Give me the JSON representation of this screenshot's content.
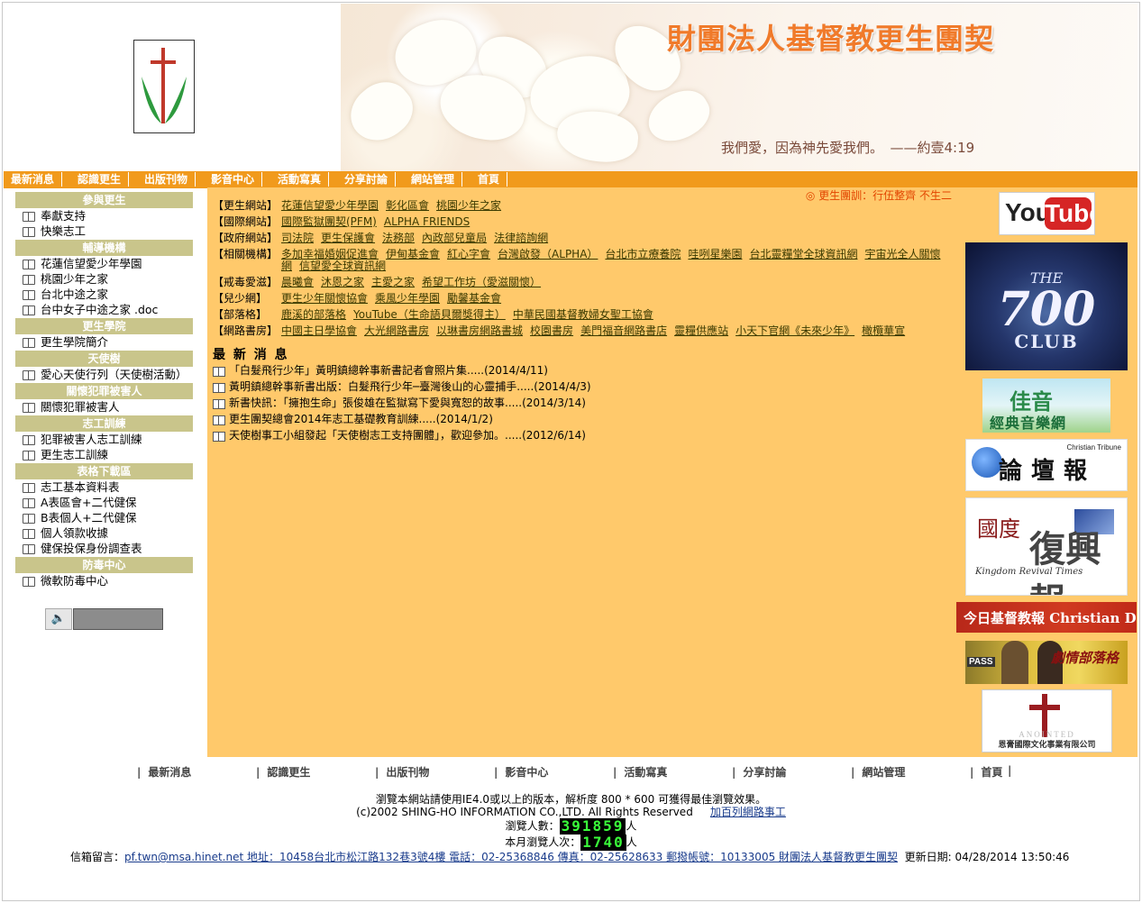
{
  "header": {
    "org_title": "財團法人基督教更生團契",
    "verse": "我們愛，因為神先愛我們。　——約壹4:19"
  },
  "nav": [
    "最新消息",
    "認識更生",
    "出版刊物",
    "影音中心",
    "活動寫真",
    "分享討論",
    "網站管理",
    "首頁"
  ],
  "sidebar": {
    "sections": [
      {
        "title": "參與更生",
        "items": [
          "奉獻支持",
          "快樂志工"
        ]
      },
      {
        "title": "輔導機構",
        "items": [
          "花蓮信望愛少年學園",
          "桃園少年之家",
          "台北中途之家",
          "台中女子中途之家 .doc"
        ]
      },
      {
        "title": "更生學院",
        "items": [
          "更生學院簡介"
        ]
      },
      {
        "title": "天使樹",
        "items": [
          "愛心天使行列（天使樹活動）"
        ]
      },
      {
        "title": "關懷犯罪被害人",
        "items": [
          "關懷犯罪被害人"
        ]
      },
      {
        "title": "志工訓練",
        "items": [
          "犯罪被害人志工訓練",
          "更生志工訓練"
        ]
      },
      {
        "title": "表格下載區",
        "items": [
          "志工基本資料表",
          "A表區會+二代健保",
          "B表個人+二代健保",
          "個人領款收據",
          "健保投保身份調查表"
        ]
      },
      {
        "title": "防毒中心",
        "items": [
          "微軟防毒中心"
        ]
      }
    ],
    "player_icon": "speaker-icon"
  },
  "main": {
    "marquee": "◎ 更生團訓：行伍整齊 不生二",
    "link_rows": [
      {
        "label": "【更生網站】",
        "items": [
          "花蓮信望愛少年學園",
          "彰化區會",
          "桃園少年之家"
        ]
      },
      {
        "label": "【國際網站】",
        "items": [
          "國際監獄團契(PFM)",
          "ALPHA FRIENDS"
        ]
      },
      {
        "label": "【政府網站】",
        "items": [
          "司法院",
          "更生保護會",
          "法務部",
          "內政部兒童局",
          "法律諮詢網"
        ]
      },
      {
        "label": "【相關機構】",
        "items": [
          "多加幸福婚姻促進會",
          "伊甸基金會",
          "紅心字會",
          "台灣啟發（ALPHA）",
          "台北市立療養院",
          "哇咧星樂園",
          "台北靈糧堂全球資訊網",
          "宇宙光全人關懷網",
          "信望愛全球資訊網"
        ]
      },
      {
        "label": "【戒毒愛滋】",
        "items": [
          "晨曦會",
          "沐恩之家",
          "主愛之家",
          "希望工作坊（愛滋關懷）"
        ]
      },
      {
        "label": "【兒少網】",
        "items": [
          "更生少年關懷協會",
          "乘風少年學園",
          "勵馨基金會"
        ]
      },
      {
        "label": "【部落格】",
        "items": [
          "鹿溪的部落格",
          "YouTube（生命語貝爾獎得主）",
          "中華民國基督教婦女聖工協會"
        ]
      },
      {
        "label": "【網路書房】",
        "items": [
          "中國主日學協會",
          "大光網路書房",
          "以琳書房網路書城",
          "校園書房",
          "美門福音網路書店",
          "靈糧供應站",
          "小天下官網《未來少年》",
          "橄欖華宣"
        ]
      }
    ],
    "news_title": "最 新 消 息",
    "news": [
      "「白髮飛行少年」黃明鎮總幹事新書記者會照片集.....(2014/4/11)",
      "黃明鎮總幹事新書出版：白髮飛行少年─臺灣後山的心靈捕手.....(2014/4/3)",
      "新書快訊：「擁抱生命」張俊雄在監獄寫下愛與寬恕的故事.....(2014/3/14)",
      "更生團契總會2014年志工基礎教育訓練.....(2014/1/2)",
      "天使樹事工小組發起「天使樹志工支持團體」，歡迎參加。.....(2012/6/14)"
    ]
  },
  "ads": {
    "youtube": {
      "you": "You",
      "tube": "Tube"
    },
    "club700": {
      "the": "THE",
      "num": "700",
      "club": "CLUB"
    },
    "jiayin": {
      "top": "佳音",
      "bottom": "經典音樂網"
    },
    "luntan": {
      "title": "論壇報",
      "sub": "Christian Tribune"
    },
    "kingdom": {
      "left": "國度",
      "right": "復興報",
      "en": "Kingdom Revival Times"
    },
    "daily": {
      "title": "今日基督教報 Christian Daily"
    },
    "pass": {
      "tag": "PASS",
      "title": "劇情部落格"
    },
    "anointed": {
      "word": "ANOINTED",
      "org": "恩膏國際文化事業有限公司"
    }
  },
  "footer": {
    "nav": [
      "最新消息",
      "認識更生",
      "出版刊物",
      "影音中心",
      "活動寫真",
      "分享討論",
      "網站管理",
      "首頁"
    ],
    "browser_note": "瀏覽本網站請使用IE4.0或以上的版本，解析度 800 * 600 可獲得最佳瀏覽效果。",
    "copyright": "(c)2002 SHING-HO INFORMATION CO.,LTD. All Rights Reserved",
    "join_link": "加百列網路事工",
    "visitors_label": "瀏覽人數：",
    "visitors": "391859",
    "visitors_unit": "人",
    "month_label": "本月瀏覽人次：",
    "month": "1740",
    "month_unit": "人",
    "contact_label": "信箱留言：",
    "contact": "pf.twn@msa.hinet.net 地址：10458台北市松江路132巷3號4樓 電話：02-25368846 傳真：02-25628633 郵撥帳號：10133005 財團法人基督教更生團契",
    "updated": "更新日期: 04/28/2014 13:50:46"
  },
  "colors": {
    "nav": "#f19a1c",
    "panel": "#ffc96b",
    "section": "#c9c58b",
    "title": "#f07a2a"
  }
}
